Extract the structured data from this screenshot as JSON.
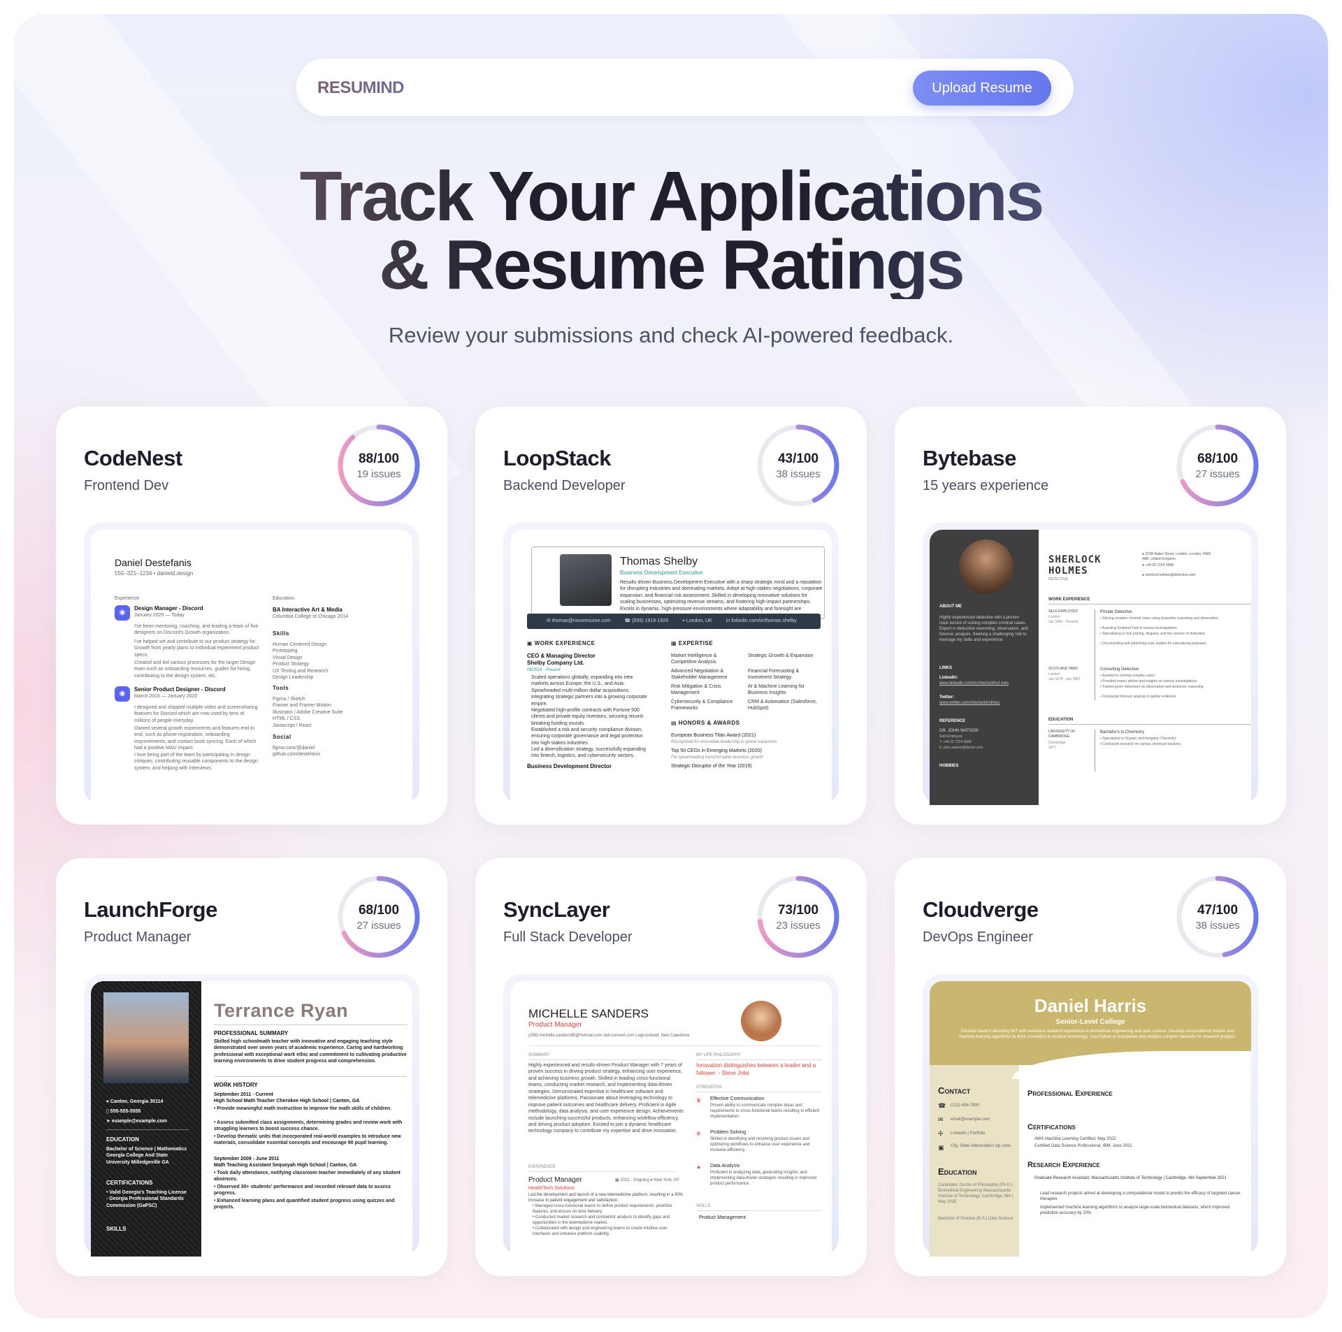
{
  "nav": {
    "brand": "RESUMIND",
    "upload_label": "Upload Resume"
  },
  "hero": {
    "title_line1": "Track Your Applications",
    "title_line2": "& Resume Ratings",
    "subtitle": "Review your submissions and check AI-powered feedback."
  },
  "colors": {
    "accent": "#6677ee",
    "ring_start": "#f29ac0",
    "ring_end": "#6a78f0",
    "ring_track": "#e9e9ef"
  },
  "cards": [
    {
      "company": "CodeNest",
      "role": "Frontend Dev",
      "score_text": "88/100",
      "issues": "19 issues",
      "score": 88
    },
    {
      "company": "LoopStack",
      "role": "Backend Developer",
      "score_text": "43/100",
      "issues": "38 issues",
      "score": 43
    },
    {
      "company": "Bytebase",
      "role": "15 years experience",
      "score_text": "68/100",
      "issues": "27 issues",
      "score": 68
    },
    {
      "company": "LaunchForge",
      "role": "Product Manager",
      "score_text": "68/100",
      "issues": "27 issues",
      "score": 68
    },
    {
      "company": "SyncLayer",
      "role": "Full Stack Developer",
      "score_text": "73/100",
      "issues": "23 issues",
      "score": 73
    },
    {
      "company": "Cloudverge",
      "role": "DevOps Engineer",
      "score_text": "47/100",
      "issues": "38 issues",
      "score": 47
    }
  ],
  "resumes": {
    "r1": {
      "name": "Daniel Destefanis",
      "contact": "555–321–1234  •  danield.design",
      "experience_h": "Experience",
      "job1": "Design Manager - Discord",
      "job1_date": "January 2020 — Today",
      "job1_p1": "I've been mentoring, coaching, and leading a team of five designers on Discord's Growth organization.",
      "job1_p2": "I've helped set and contribute to our product strategy for Growth from yearly plans to individual experiment product specs.",
      "job1_p3": "Created and led various processes for the larger Design team such as onboarding resources, guides for hiring, contributing to the design system, etc.",
      "job2": "Senior Product Designer - Discord",
      "job2_date": "March 2016 — January 2020",
      "job2_p1": "I designed and shipped multiple video and screensharing features for Discord which are now used by tens of millions of people everyday.",
      "job2_p2": "Owned several growth experiments and features end to end, such as phone registration, onboarding improvements, and contact book syncing. Each of which had a positive MAU impact.",
      "job2_p3": "I love being part of the team by participating in design critiques, contributing reusable components to the design system, and helping with interviews.",
      "education_h": "Education",
      "edu1": "BA Interactive Art & Media",
      "edu2": "Columbia College of Chicago 2014",
      "skills_h": "Skills",
      "skills": "Human Centered Design\nPrototyping\nVisual Design\nProduct Strategy\nUX Testing and Research\nDesign Leadership",
      "tools_h": "Tools",
      "tools": "Figma / Sketch\nFramer and Framer Motion\nIllustrator / Adobe Creative Suite\nHTML / CSS\nJavascript / React",
      "social_h": "Social",
      "social": "figma.com/@daniel\ngithub.com/destefanis"
    },
    "r2": {
      "name": "Thomas Shelby",
      "title": "Business Development Executive",
      "summary": "Results-driven Business Development Executive with a sharp strategic mind and a reputation for disrupting industries and dominating markets. Adept at high-stakes negotiations, corporate expansion, and financial risk assessment. Skilled in developing innovative solutions for scaling businesses, optimizing revenue streams, and fostering high-impact partnerships. Excels in dynamic, high-pressure environments where adaptability and foresight are paramount.",
      "email": "thomas@novoresume.com",
      "phone": "(555) 1919-1929",
      "location": "London, UK",
      "linkedin": "linkedin.com/in/thomas.shelby",
      "work_h": "WORK EXPERIENCE",
      "job_title": "CEO & Managing Director",
      "company": "Shelby Company Ltd.",
      "dates": "06/2016 - Present",
      "b1": "Scaled operations globally, expanding into new markets across Europe, the U.S., and Asia.",
      "b2": "Spearheaded multi-million-dollar acquisitions, integrating strategic partners into a growing corporate empire.",
      "b3": "Negotiated high-profile contracts with Fortune 500 clients and private equity investors, securing record-breaking funding rounds.",
      "b4": "Established a risk and security compliance division, ensuring corporate governance and legal protection into high-stakes industries.",
      "b5": "Led a diversification strategy, successfully expanding into fintech, logistics, and cybersecurity sectors.",
      "job2_title": "Business Development Director",
      "expertise_h": "EXPERTISE",
      "ex1": "Market Intelligence & Competitive Analysis",
      "ex2": "Strategic Growth & Expansion",
      "ex3": "Advanced Negotiation & Stakeholder Management",
      "ex4": "Financial Forecasting & Investment Strategy",
      "ex5": "Risk Mitigation & Crisis Management",
      "ex6": "AI & Machine Learning for Business Insights",
      "ex7": "Cybersecurity & Compliance Frameworks",
      "ex8": "CRM & Automation (Salesforce, HubSpot)",
      "honors_h": "HONORS & AWARDS",
      "h1": "European Business Titan Award (2021)",
      "h1s": "Recognized for innovative leadership in global expansion",
      "h2": "Top 50 CEOs in Emerging Markets (2020)",
      "h2s": "For spearheading transformative business growth",
      "h3": "Strategic Disruptor of the Year (2019)"
    },
    "r3": {
      "name1": "SHERLOCK",
      "name2": "HOLMES",
      "role": "DETECTIVE",
      "address": "221B Baker Street, London, London, NW6 4AB, United Kingdom",
      "phone": "+44 20 7224 3688",
      "email": "sherlock.holmes@detective.com",
      "about_h": "ABOUT ME",
      "about": "Highly experienced detective with a proven track record of solving complex criminal cases. Expert in deductive reasoning, observation, and forensic analysis. Seeking a challenging role to leverage my skills and experience.",
      "links_h": "LINKS",
      "linkedin_l": "LinkedIn:",
      "linkedin": "www.linkedin.com/in/sherlockhol mes",
      "twitter_l": "Twitter:",
      "twitter": "www.twitter.com/sherlockholmes",
      "ref_h": "REFERENCE",
      "ref_name": "DR. JOHN WATSON",
      "ref_role": "Self-Employed",
      "ref_tel": "T: +44 20 7224 3688",
      "ref_email": "E: john.watson@doctor.com",
      "hobbies_h": "HOBBIES",
      "work_h": "WORK EXPERIENCE",
      "w1_org": "SELF-EMPLOYED",
      "w1_loc": "London",
      "w1_date": "Jan 1881 - Present",
      "w1_title": "Private Detective",
      "w1_b1": "• Solving complex criminal cases using deductive reasoning and observation",
      "w1_b2": "• Assisting Scotland Yard in various investigations",
      "w1_b3": "• Specializing in lock picking, disguise, and the science of deduction",
      "w1_b4": "• Documenting and publishing case studies for educational purposes",
      "w2_org": "SCOTLAND YARD",
      "w2_loc": "London",
      "w2_date": "Jan 1878 - Jan 1881",
      "w2_title": "Consulting Detective",
      "w2_b1": "• Assisted in solving complex cases",
      "w2_b2": "• Provided expert advice and insights on various investigations",
      "w2_b3": "• Trained junior detectives on observation and deductive reasoning",
      "w2_b4": "• Conducted forensic analysis to gather evidence",
      "edu_h": "EDUCATION",
      "e_org": "UNIVERSITY OF CAMBRIDGE",
      "e_loc": "Cambridge",
      "e_date": "1877",
      "e_title": "Bachelor's in Chemistry",
      "e_b1": "• Specialized in Organic and Inorganic Chemistry",
      "e_b2": "• Conducted research on various chemical reactions"
    },
    "r4": {
      "name": "Terrance Ryan",
      "location": "Canton, Georgia 30114",
      "phone": "555-555-5555",
      "email": "example@example.com",
      "edu_h": "EDUCATION",
      "edu": "Bachelor of Science  |  Mathematics\nGeorgia College And State University Milledgeville GA",
      "cert_h": "CERTIFICATIONS",
      "cert": "• Valid Georgia's Teaching License - Georgia Professional Standards Commission (GaPSC)",
      "skills_h": "SKILLS",
      "summary_h": "PROFESSIONAL SUMMARY",
      "summary": "Skilled high schoolmath teacher with innovative and engaging teaching style demonstrated over seven years of academic experience. Caring and hardworking professional with exceptional work ethic and commitment to cultivating productive learning environments to drive student progress and comprehension.",
      "history_h": "WORK HISTORY",
      "j1_date": "September 2011  -  Current",
      "j1_title": "High School Math Teacher     Cherokee High School    |  Canton, GA",
      "j1_b1": "• Provide meaningful math instruction to improve the math skills of children.",
      "j1_b2": "• Assess submitted class assignments, determining grades and review work with struggling learners to boost success chance.",
      "j1_b3": "• Develop thematic units that incorporated real-world examples to introduce new materials, consolidate essential concepts and encourage 90 pupil learning.",
      "j2_date": "September 2009  -  June 2011",
      "j2_title": "Math Teaching Assistant     Sequoyah High School    |  Canton, GA",
      "j2_b1": "• Took daily attendance, notifying classroom teacher immediately of any student absences.",
      "j2_b2": "• Observed 30+ students' performance and recorded relevant data to assess progress.",
      "j2_b3": "• Enhanced learning plans and quantified student progress using quizzes and projects."
    },
    "r5": {
      "name": "MICHELLE SANDERS",
      "title": "Product Manager",
      "contact": "(288)     michelle.sanders85@hotmail.com     dull-convert.com     Legrosstead, New Caledonia",
      "summary_h": "SUMMARY",
      "summary": "Highly experienced and results-driven Product Manager with 7 years of proven success in driving product strategy, enhancing user experience, and achieving business growth. Skilled in leading cross-functional teams, conducting market research, and implementing data-driven strategies. Demonstrated expertise in healthcare software and telemedicine platforms. Passionate about leveraging technology to improve patient outcomes and healthcare delivery. Proficient in Agile methodology, data analysis, and user experience design. Achievements include launching successful products, enhancing workflow efficiency, and driving product adoption. Excited to join a dynamic healthcare technology company to contribute my expertise and drive innovation.",
      "exp_h": "EXPERIENCE",
      "job": "Product Manager",
      "company": "HealthTech Solutions",
      "dates": "2022 - Ongoing",
      "loc": "New York, NY",
      "job_desc": "Led the development and launch of a new telemedicine platform, resulting in a 30% increase in patient engagement and satisfaction.",
      "jb1": "• Managed cross-functional teams to define product requirements, prioritize features, and ensure on-time delivery.",
      "jb2": "• Conducted market research and competitor analysis to identify gaps and opportunities in the telemedicine market.",
      "jb3": "• Collaborated with design and engineering teams to create intuitive user interfaces and enhance platform usability.",
      "phil_h": "MY LIFE PHILOSOPHY",
      "phil": "Innovation distinguishes between a leader and a follower. - Steve Jobs",
      "str_h": "STRENGTHS",
      "s1": "Effective Communication",
      "s1d": "Proven ability to communicate complex ideas and requirements to cross-functional teams resulting in efficient implementation.",
      "s2": "Problem Solving",
      "s2d": "Skilled in identifying and resolving product issues and optimizing workflows to enhance user experience and increase efficiency.",
      "s3": "Data Analysis",
      "s3d": "Proficient in analyzing data, generating insights, and implementing data-driven strategies resulting in improved product performance.",
      "skills_h": "SKILLS",
      "skill1": "Product Management"
    },
    "r6": {
      "name": "Daniel Harris",
      "title": "Senior-Level College",
      "intro": "Doctoral student attending MIT with extensive research experience in biomedical engineering and data science. Develop computational models and machine learning algorithms to drive innovation in medical technology. Use Python to manipulate and analyze complex datasets for research projects.",
      "contact_h": "Contact",
      "phone": "(123) 456-7890",
      "email": "email@example.com",
      "links": "LinkedIn | Portfolio",
      "addr": "City, State Abbreviation zip code",
      "edu_h": "Education",
      "edu1": "Candidate: Doctor of Philosophy (Ph.D.) Biomedical Engineering Massachusetts Institute of Technology, Cambridge, MA | May 2025",
      "edu2": "Bachelor of Science (B.S.) Data Science",
      "pro_h": "Professional Experience",
      "cert_h": "Certifications",
      "c1": "AWS Machine Learning Certified, May 2022",
      "c2": "Certified Data Science Professional, IBM, June 2021",
      "res_h": "Research Experience",
      "res1": "Graduate Research Assistant, Massachusetts Institute of Technology | Cambridge, MA September 2021",
      "rb1": "Lead research projects aimed at developing a computational model to predict the efficacy of targeted cancer therapies",
      "rb2": "Implemented machine learning algorithms to analyze large-scale biomedical datasets, which improved prediction accuracy by 20%"
    }
  }
}
